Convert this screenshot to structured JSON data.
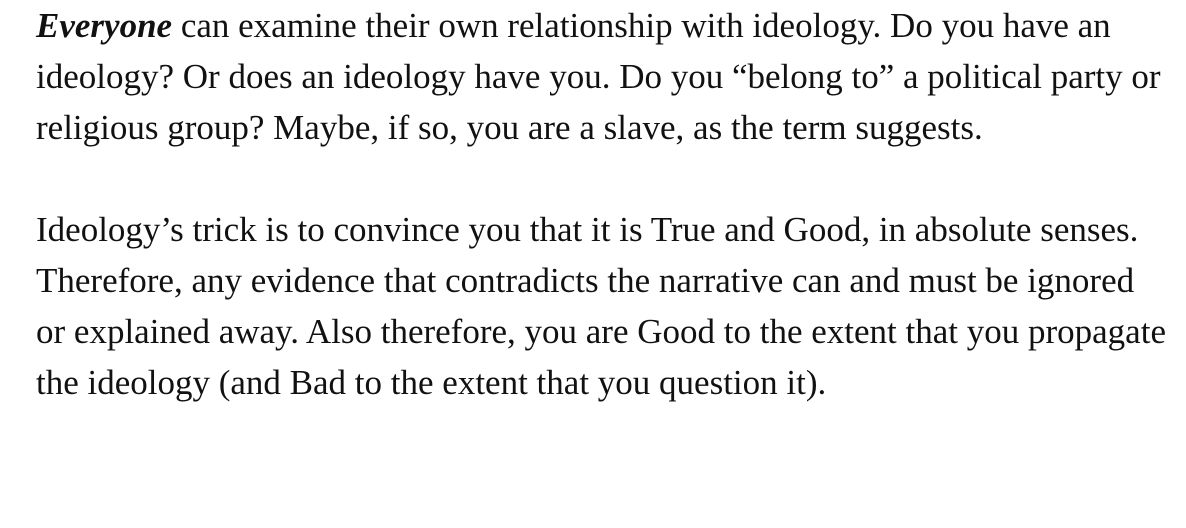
{
  "article": {
    "paragraphs": [
      {
        "emphasis": "Everyone",
        "text": " can examine their own relationship with ideology. Do you have an ideology? Or does an ideology have you. Do you “belong to” a political party or religious group? Maybe, if so, you are a slave, as the term suggests."
      },
      {
        "text": "Ideology’s trick is to convince you that it is True and Good, in absolute senses. Therefore, any evidence that contradicts the narrative can and must be ignored or explained away. Also therefore, you are Good to the extent that you propagate the ideology (and Bad to the extent that you question it)."
      }
    ]
  }
}
